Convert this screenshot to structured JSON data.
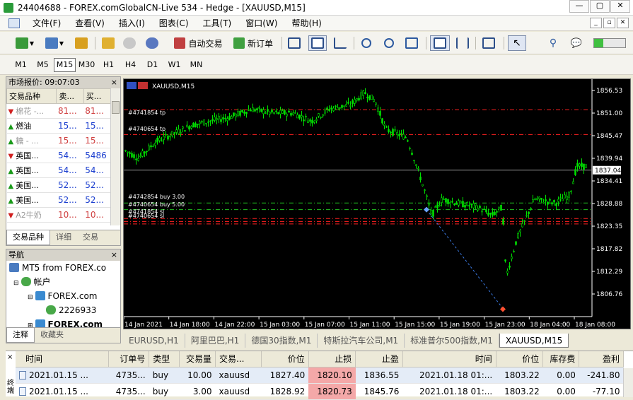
{
  "window": {
    "title": "24404688 - FOREX.comGlobalCN-Live 534 - Hedge - [XAUUSD,M15]"
  },
  "menu": [
    "文件(F)",
    "查看(V)",
    "插入(I)",
    "图表(C)",
    "工具(T)",
    "窗口(W)",
    "帮助(H)"
  ],
  "toolbar": {
    "autotrade_label": "自动交易",
    "neworder_label": "新订单"
  },
  "timeframes": [
    "M1",
    "M5",
    "M15",
    "M30",
    "H1",
    "H4",
    "D1",
    "W1",
    "MN"
  ],
  "active_timeframe": "M15",
  "market_watch": {
    "title": "市场报价: 09:07:03",
    "columns": [
      "交易品种",
      "卖...",
      "买..."
    ],
    "rows": [
      {
        "symbol": "棉花 -...",
        "bid": "81...",
        "ask": "81...",
        "dir": "down",
        "gray": true
      },
      {
        "symbol": "燃油",
        "bid": "15...",
        "ask": "15...",
        "dir": "up",
        "gray": false
      },
      {
        "symbol": "糖 - ...",
        "bid": "15...",
        "ask": "15...",
        "dir": "up",
        "gray": true
      },
      {
        "symbol": "英国...",
        "bid": "54...",
        "ask": "5486",
        "dir": "down",
        "gray": false
      },
      {
        "symbol": "英国...",
        "bid": "54...",
        "ask": "54...",
        "dir": "up",
        "gray": false
      },
      {
        "symbol": "美国...",
        "bid": "52...",
        "ask": "52...",
        "dir": "up",
        "gray": false
      },
      {
        "symbol": "美国...",
        "bid": "52...",
        "ask": "52...",
        "dir": "up",
        "gray": false
      },
      {
        "symbol": "A2牛奶",
        "bid": "10...",
        "ask": "10...",
        "dir": "down",
        "gray": true
      }
    ],
    "tabs": [
      "交易品种",
      "详细",
      "交易"
    ]
  },
  "navigator": {
    "title": "导航",
    "items": [
      "MT5 from FOREX.co",
      "帐户",
      "FOREX.com",
      "2226933",
      "FOREX.com"
    ],
    "tabs": [
      "注释",
      "收藏夹"
    ]
  },
  "chart": {
    "symbol_label": "XAUUSD,M15",
    "price_ticks": [
      "1856.53",
      "1851.00",
      "1845.47",
      "1839.94",
      "1834.41",
      "1828.88",
      "1823.35",
      "1817.82",
      "1812.29",
      "1806.76"
    ],
    "current_price": "1837.04",
    "time_ticks": [
      "14 Jan 2021",
      "14 Jan 18:00",
      "14 Jan 22:00",
      "15 Jan 03:00",
      "15 Jan 07:00",
      "15 Jan 11:00",
      "15 Jan 15:00",
      "15 Jan 19:00",
      "15 Jan 23:00",
      "18 Jan 04:00",
      "18 Jan 08:00"
    ],
    "order_labels": [
      "#4741854 tp",
      "#4740654 tp",
      "#4742854 buy 3.00",
      "#4740654 buy 5.00",
      "#4741854 sl",
      "#4740654 sl"
    ],
    "colors": {
      "bull": "#00e000",
      "tp": "#ff2020",
      "buy": "#20c020",
      "current": "#909090"
    }
  },
  "chart_tabs": [
    "EURUSD,H1",
    "阿里巴巴,H1",
    "德国30指数,M1",
    "特斯拉汽车公司,M1",
    "标准普尔500指数,M1",
    "XAUUSD,M15"
  ],
  "active_chart_tab": "XAUUSD,M15",
  "terminal": {
    "close_icon": "×",
    "side_label": "终端",
    "columns": [
      "时间",
      "订单号",
      "类型",
      "交易量",
      "交易...",
      "价位",
      "止损",
      "止盈",
      "时间",
      "价位",
      "库存费",
      "盈利"
    ],
    "rows": [
      [
        "2021.01.15 ...",
        "4735...",
        "buy",
        "10.00",
        "xauusd",
        "1827.40",
        "1820.10",
        "1836.55",
        "2021.01.18 01:...",
        "1803.22",
        "0.00",
        "-241.80"
      ],
      [
        "2021.01.15 ...",
        "4735...",
        "buy",
        "3.00",
        "xauusd",
        "1828.92",
        "1820.73",
        "1845.76",
        "2021.01.18 01:...",
        "1803.22",
        "0.00",
        "-77.10"
      ]
    ]
  }
}
